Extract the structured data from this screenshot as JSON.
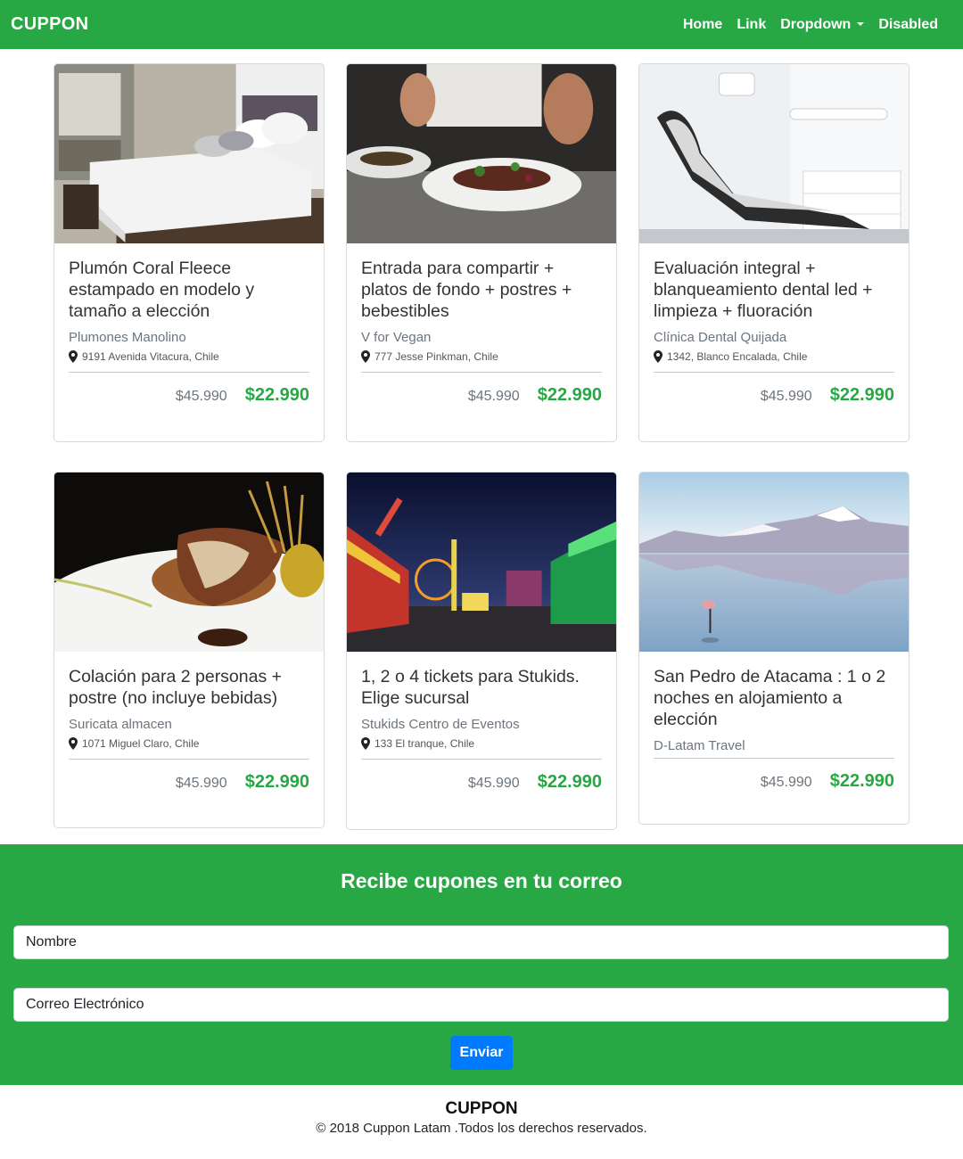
{
  "navbar": {
    "brand": "CUPPON",
    "links": [
      {
        "label": "Home"
      },
      {
        "label": "Link"
      },
      {
        "label": "Dropdown"
      },
      {
        "label": "Disabled"
      }
    ]
  },
  "cards": [
    {
      "title": "Plumón Coral Fleece estampado en modelo y tamaño a elección",
      "vendor": "Plumones Manolino",
      "address": "9191 Avenida Vitacura, Chile",
      "old_price": "$45.990",
      "new_price": "$22.990",
      "image": "bedroom"
    },
    {
      "title": "Entrada para compartir + platos de fondo + postres + bebestibles",
      "vendor": "V for Vegan",
      "address": "777 Jesse Pinkman, Chile",
      "old_price": "$45.990",
      "new_price": "$22.990",
      "image": "chef-plating"
    },
    {
      "title": "Evaluación integral + blanqueamiento dental led + limpieza + fluoración",
      "vendor": "Clínica Dental Quijada",
      "address": "1342, Blanco Encalada, Chile",
      "old_price": "$45.990",
      "new_price": "$22.990",
      "image": "dental-chair"
    },
    {
      "title": "Colación para 2 personas + postre (no incluye bebidas)",
      "vendor": "Suricata almacen",
      "address": "1071 Miguel Claro, Chile",
      "old_price": "$45.990",
      "new_price": "$22.990",
      "image": "meat-dish"
    },
    {
      "title": "1, 2 o 4 tickets para Stukids. Elige sucursal",
      "vendor": "Stukids Centro de Eventos",
      "address": "133 El tranque, Chile",
      "old_price": "$45.990",
      "new_price": "$22.990",
      "image": "fair-night"
    },
    {
      "title": "San Pedro de Atacama : 1 o 2 noches en alojamiento a elección",
      "vendor": "D-Latam Travel",
      "address": "",
      "old_price": "$45.990",
      "new_price": "$22.990",
      "image": "salt-lake"
    }
  ],
  "newsletter": {
    "title": "Recibe cupones en tu correo",
    "name_placeholder": "Nombre",
    "email_placeholder": "Correo Electrónico",
    "submit_label": "Enviar"
  },
  "footer": {
    "brand": "CUPPON",
    "copyright": "© 2018 Cuppon Latam .Todos los derechos reservados."
  },
  "colors": {
    "brand_green": "#28a745",
    "button_blue": "#007bff"
  }
}
